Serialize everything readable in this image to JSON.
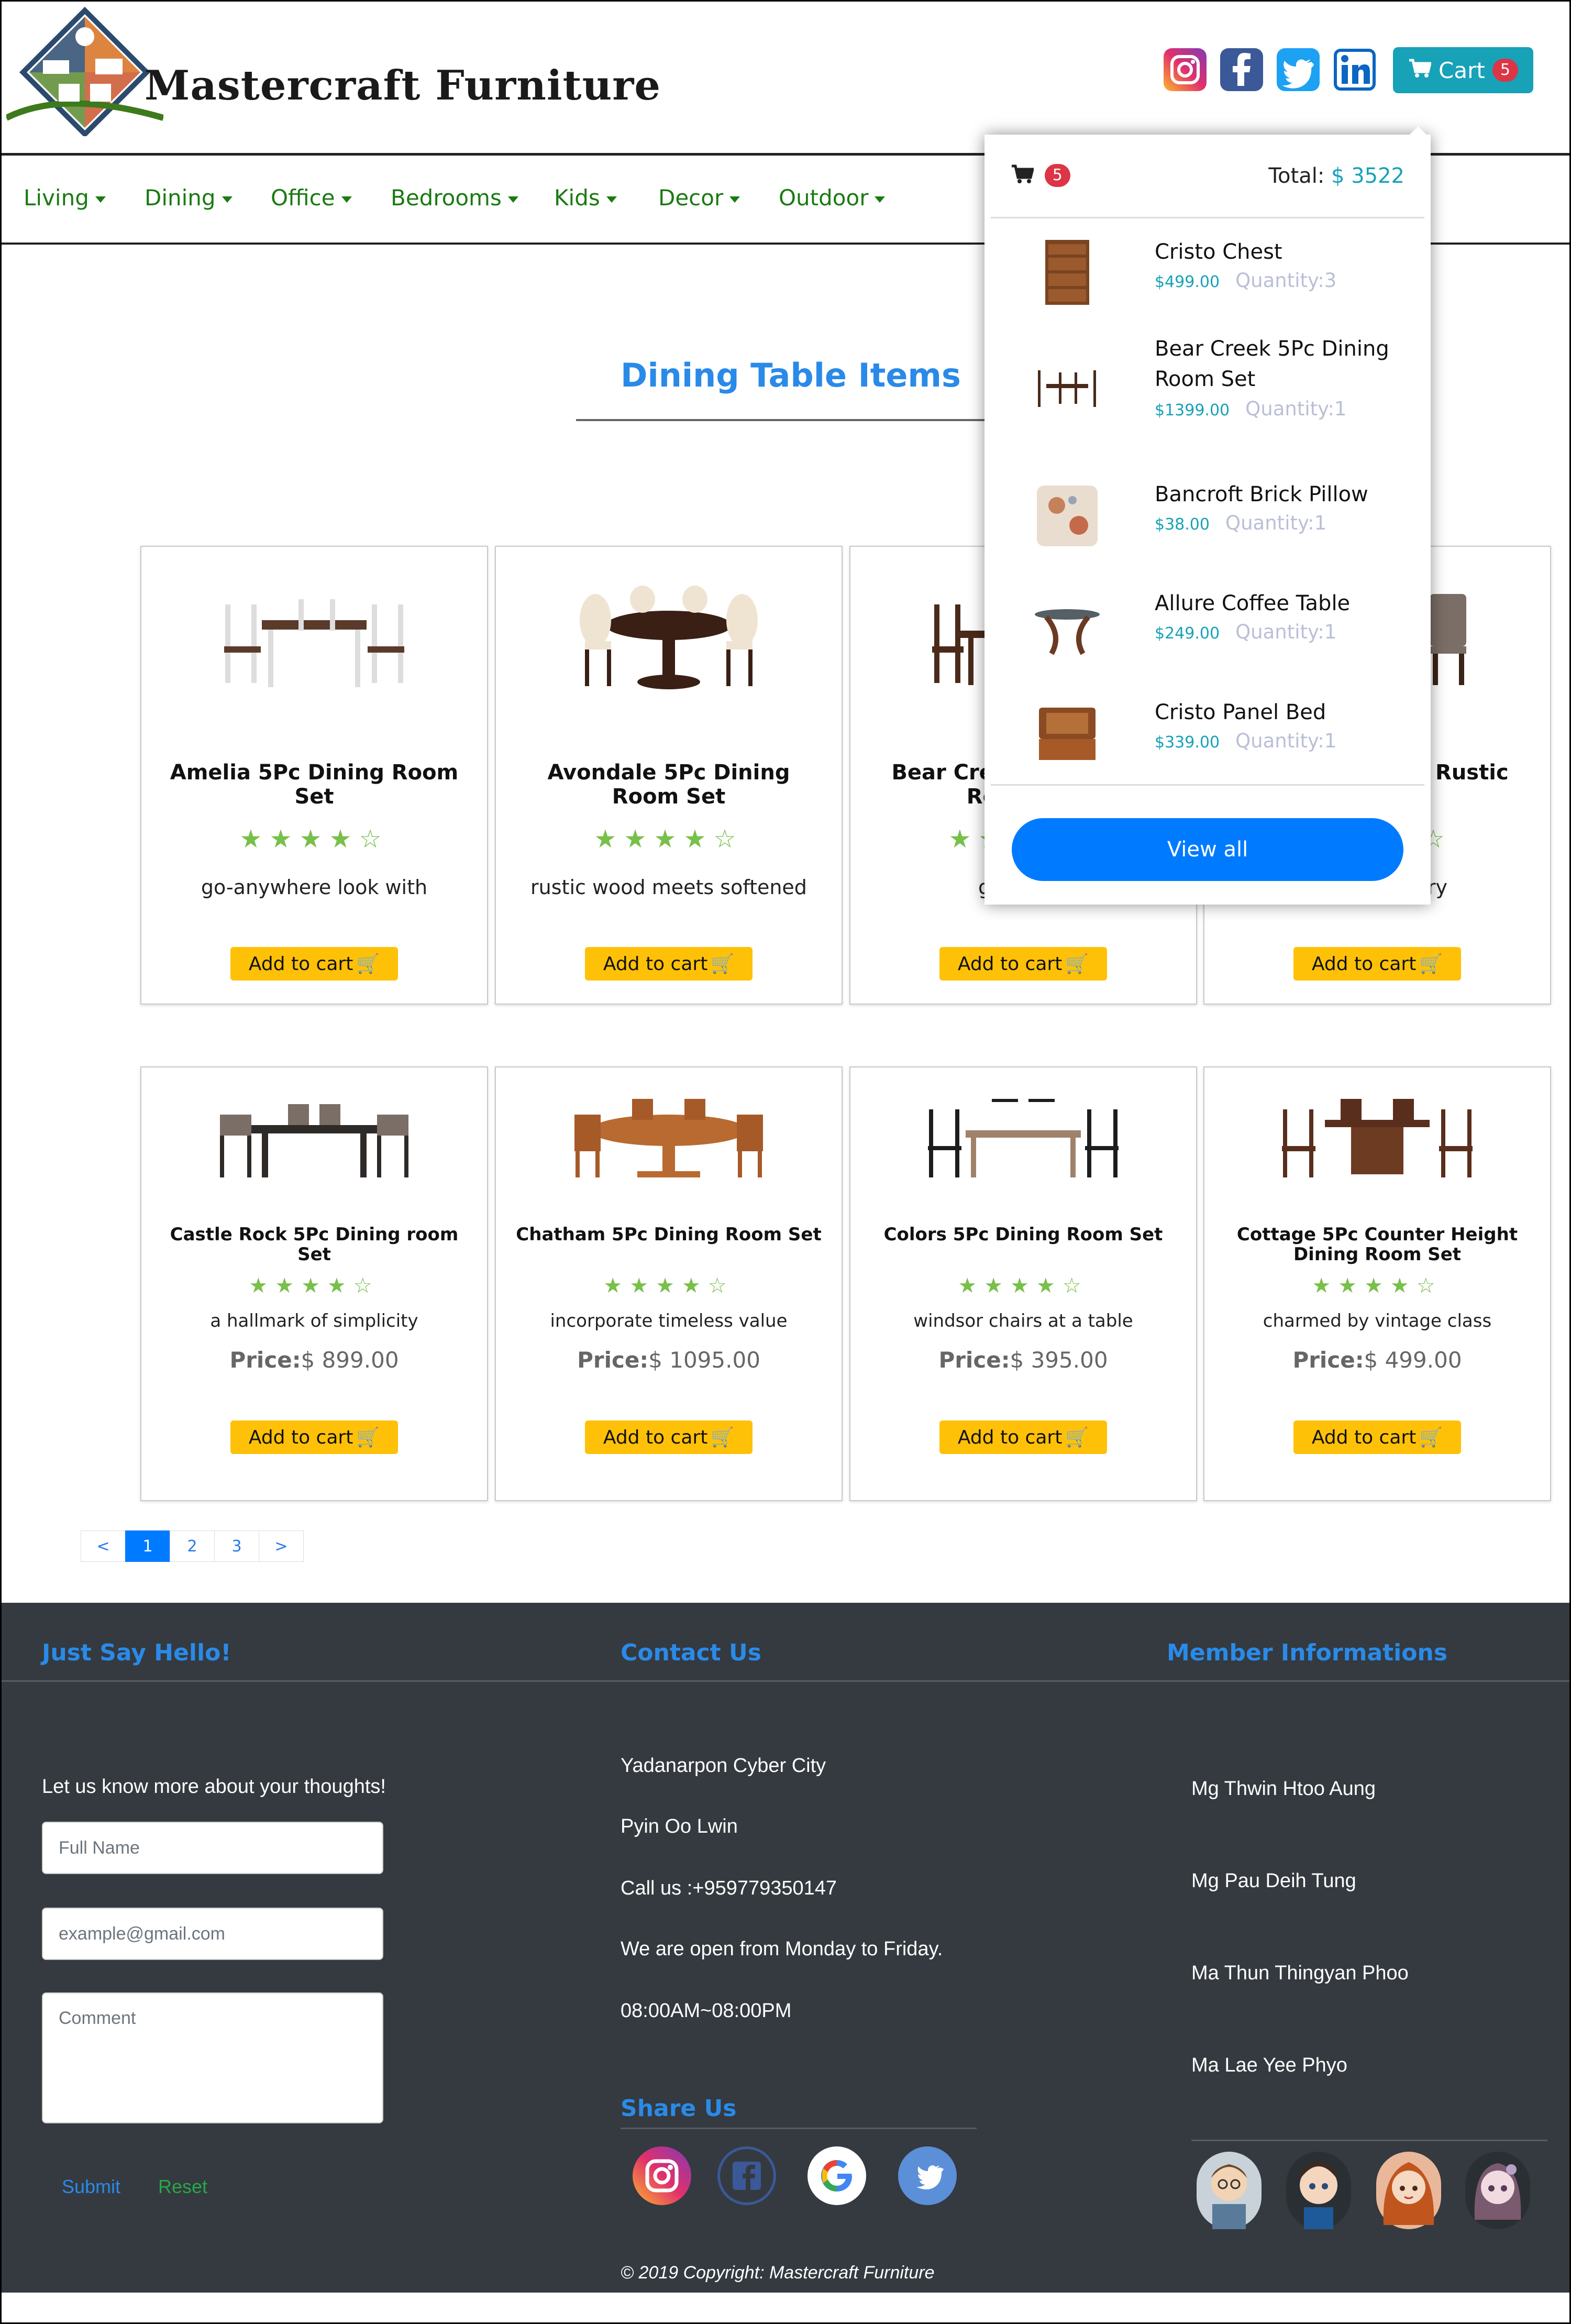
{
  "brand": {
    "name": "Mastercraft Furniture"
  },
  "header": {
    "social_icons": [
      "instagram-icon",
      "facebook-icon",
      "twitter-icon",
      "linkedin-icon"
    ],
    "cart_label": "Cart",
    "cart_count": "5"
  },
  "nav": {
    "items": [
      {
        "label": "Living"
      },
      {
        "label": "Dining"
      },
      {
        "label": "Office"
      },
      {
        "label": "Bedrooms"
      },
      {
        "label": "Kids"
      },
      {
        "label": "Decor"
      },
      {
        "label": "Outdoor"
      }
    ]
  },
  "main": {
    "title": "Dining Table Items",
    "price_label": "Price:",
    "add_to_cart_label": "Add to cart",
    "rating": 4,
    "products_row1": [
      {
        "name": "Amelia 5Pc Dining Room Set",
        "desc": "go-anywhere look with"
      },
      {
        "name": "Avondale 5Pc Dining Room Set",
        "desc": "rustic wood meets softened"
      },
      {
        "name": "Bear Creek 5Pc Dining Room Set",
        "desc": "gather in"
      },
      {
        "name": "Bellingham 5Pc Rustic Dining",
        "desc": "contemporary"
      }
    ],
    "products_row2": [
      {
        "name": "Castle Rock 5Pc Dining room Set",
        "desc": "a hallmark of simplicity",
        "price": "$ 899.00"
      },
      {
        "name": "Chatham 5Pc Dining Room Set",
        "desc": "incorporate timeless value",
        "price": "$ 1095.00"
      },
      {
        "name": "Colors 5Pc Dining Room Set",
        "desc": "windsor chairs at a table",
        "price": "$ 395.00"
      },
      {
        "name": "Cottage 5Pc Counter Height Dining Room Set",
        "desc": "charmed by vintage class",
        "price": "$ 499.00"
      }
    ]
  },
  "pagination": {
    "prev": "<",
    "pages": [
      "1",
      "2",
      "3"
    ],
    "next": ">",
    "active": "1"
  },
  "cart_dropdown": {
    "count": "5",
    "total_label": "Total:",
    "total_value": "$ 3522",
    "quantity_prefix": "Quantity:",
    "items": [
      {
        "name": "Cristo Chest",
        "price": "$499.00",
        "quantity": "3"
      },
      {
        "name": "Bear Creek 5Pc Dining Room Set",
        "price": "$1399.00",
        "quantity": "1"
      },
      {
        "name": "Bancroft Brick Pillow",
        "price": "$38.00",
        "quantity": "1"
      },
      {
        "name": "Allure Coffee Table",
        "price": "$249.00",
        "quantity": "1"
      },
      {
        "name": "Cristo Panel Bed",
        "price": "$339.00",
        "quantity": "1"
      }
    ],
    "view_all_label": "View all"
  },
  "footer": {
    "hello": {
      "heading": "Just Say Hello!",
      "intro": "Let us know more about your thoughts!",
      "name_placeholder": "Full Name",
      "email_placeholder": "example@gmail.com",
      "comment_placeholder": "Comment",
      "submit_label": "Submit",
      "reset_label": "Reset"
    },
    "contact": {
      "heading": "Contact Us",
      "lines": [
        "Yadanarpon Cyber City",
        "Pyin Oo Lwin",
        "Call us :+959779350147",
        "We are open from Monday to Friday.",
        "08:00AM~08:00PM"
      ]
    },
    "share": {
      "heading": "Share Us",
      "icons": [
        "instagram-icon",
        "facebook-icon",
        "google-icon",
        "twitter-icon"
      ]
    },
    "members": {
      "heading": "Member Informations",
      "names": [
        "Mg Thwin Htoo Aung",
        "Mg Pau Deih Tung",
        "Ma Thun Thingyan Phoo",
        "Ma Lae Yee Phyo"
      ]
    },
    "copyright": "© 2019 Copyright: Mastercraft Furniture"
  },
  "colors": {
    "accent": "#17a2b8",
    "nav_green": "#1a7a12",
    "title_blue": "#2a8ae8",
    "cart_badge": "#dc3545",
    "add_to_cart": "#ffc107",
    "footer_bg": "#343a40",
    "star_green": "#78c04a"
  }
}
